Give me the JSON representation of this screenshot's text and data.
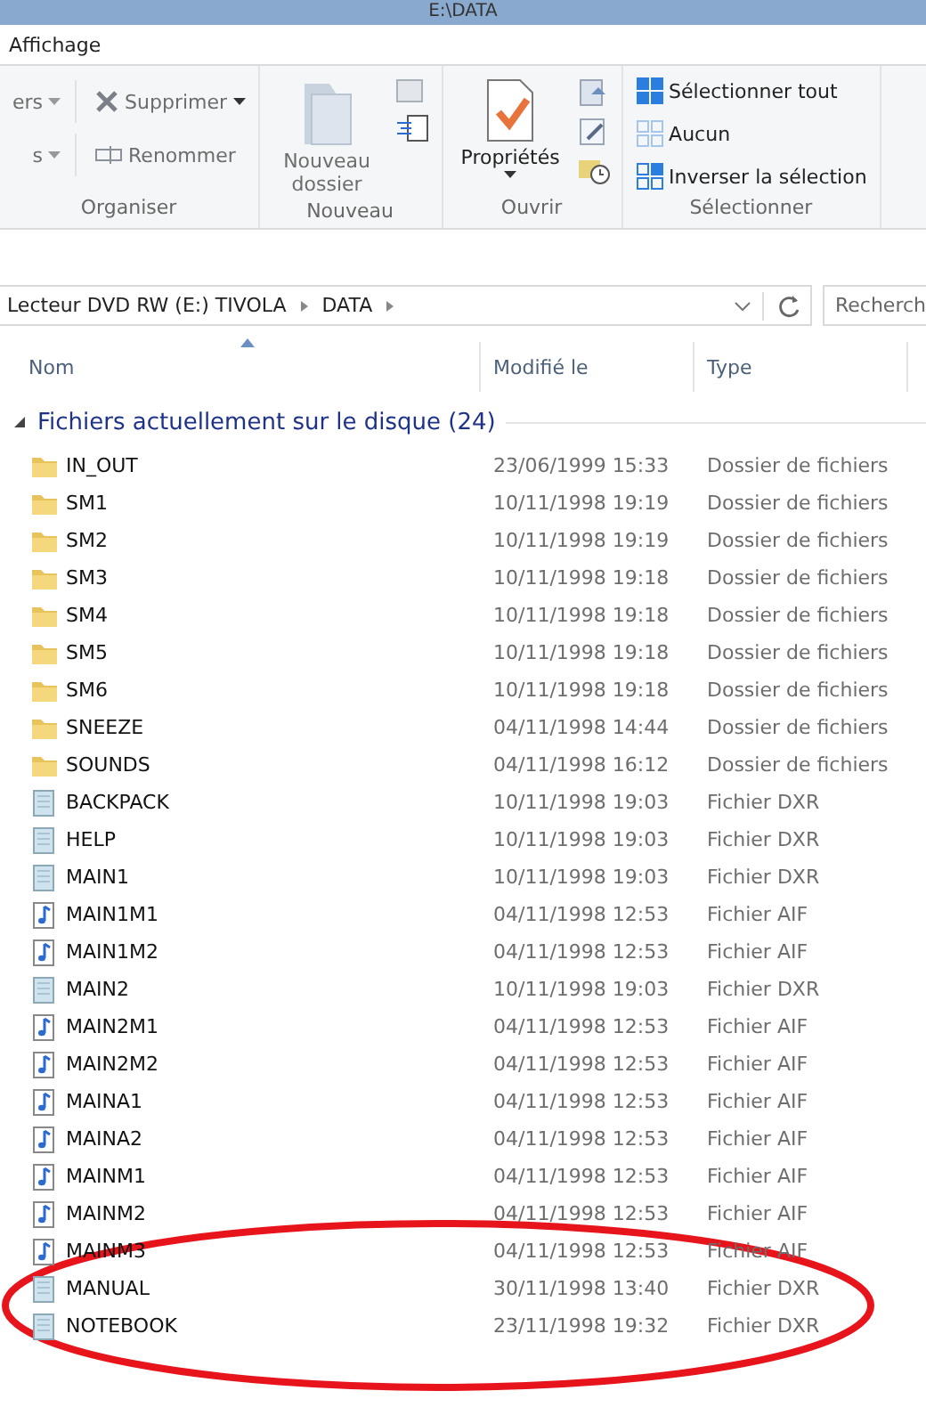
{
  "window": {
    "title": "E:\\DATA"
  },
  "menu_tabs": [
    "Affichage"
  ],
  "ribbon": {
    "groups": [
      {
        "label": "Organiser",
        "items": [
          {
            "text": "ers",
            "kind": "partial"
          },
          {
            "text": "s",
            "kind": "partial"
          },
          {
            "text": "Supprimer",
            "kind": "delete"
          },
          {
            "text": "Renommer",
            "kind": "rename"
          }
        ]
      },
      {
        "label": "Nouveau",
        "items": [
          {
            "text": "Nouveau dossier",
            "kind": "newfolder"
          }
        ]
      },
      {
        "label": "Ouvrir",
        "items": [
          {
            "text": "Propriétés",
            "kind": "properties"
          }
        ]
      },
      {
        "label": "Sélectionner",
        "items": [
          {
            "text": "Sélectionner tout",
            "kind": "selectall"
          },
          {
            "text": "Aucun",
            "kind": "none"
          },
          {
            "text": "Inverser la sélection",
            "kind": "invert"
          }
        ]
      }
    ]
  },
  "address": {
    "path": [
      "Lecteur DVD RW (E:) TIVOLA",
      "DATA"
    ],
    "search_placeholder": "Recherch"
  },
  "table": {
    "columns": [
      "Nom",
      "Modifié le",
      "Type"
    ],
    "group": "Fichiers actuellement sur le disque (24)",
    "rows": [
      {
        "name": "IN_OUT",
        "date": "23/06/1999 15:33",
        "type": "Dossier de fichiers",
        "kind": "folder"
      },
      {
        "name": "SM1",
        "date": "10/11/1998 19:19",
        "type": "Dossier de fichiers",
        "kind": "folder"
      },
      {
        "name": "SM2",
        "date": "10/11/1998 19:19",
        "type": "Dossier de fichiers",
        "kind": "folder"
      },
      {
        "name": "SM3",
        "date": "10/11/1998 19:18",
        "type": "Dossier de fichiers",
        "kind": "folder"
      },
      {
        "name": "SM4",
        "date": "10/11/1998 19:18",
        "type": "Dossier de fichiers",
        "kind": "folder"
      },
      {
        "name": "SM5",
        "date": "10/11/1998 19:18",
        "type": "Dossier de fichiers",
        "kind": "folder"
      },
      {
        "name": "SM6",
        "date": "10/11/1998 19:18",
        "type": "Dossier de fichiers",
        "kind": "folder"
      },
      {
        "name": "SNEEZE",
        "date": "04/11/1998 14:44",
        "type": "Dossier de fichiers",
        "kind": "folder"
      },
      {
        "name": "SOUNDS",
        "date": "04/11/1998 16:12",
        "type": "Dossier de fichiers",
        "kind": "folder"
      },
      {
        "name": "BACKPACK",
        "date": "10/11/1998 19:03",
        "type": "Fichier DXR",
        "kind": "dxr"
      },
      {
        "name": "HELP",
        "date": "10/11/1998 19:03",
        "type": "Fichier DXR",
        "kind": "dxr"
      },
      {
        "name": "MAIN1",
        "date": "10/11/1998 19:03",
        "type": "Fichier DXR",
        "kind": "dxr"
      },
      {
        "name": "MAIN1M1",
        "date": "04/11/1998 12:53",
        "type": "Fichier AIF",
        "kind": "aif"
      },
      {
        "name": "MAIN1M2",
        "date": "04/11/1998 12:53",
        "type": "Fichier AIF",
        "kind": "aif"
      },
      {
        "name": "MAIN2",
        "date": "10/11/1998 19:03",
        "type": "Fichier DXR",
        "kind": "dxr"
      },
      {
        "name": "MAIN2M1",
        "date": "04/11/1998 12:53",
        "type": "Fichier AIF",
        "kind": "aif"
      },
      {
        "name": "MAIN2M2",
        "date": "04/11/1998 12:53",
        "type": "Fichier AIF",
        "kind": "aif"
      },
      {
        "name": "MAINA1",
        "date": "04/11/1998 12:53",
        "type": "Fichier AIF",
        "kind": "aif"
      },
      {
        "name": "MAINA2",
        "date": "04/11/1998 12:53",
        "type": "Fichier AIF",
        "kind": "aif"
      },
      {
        "name": "MAINM1",
        "date": "04/11/1998 12:53",
        "type": "Fichier AIF",
        "kind": "aif"
      },
      {
        "name": "MAINM2",
        "date": "04/11/1998 12:53",
        "type": "Fichier AIF",
        "kind": "aif"
      },
      {
        "name": "MAINM3",
        "date": "04/11/1998 12:53",
        "type": "Fichier AIF",
        "kind": "aif"
      },
      {
        "name": "MANUAL",
        "date": "30/11/1998 13:40",
        "type": "Fichier DXR",
        "kind": "dxr"
      },
      {
        "name": "NOTEBOOK",
        "date": "23/11/1998 19:32",
        "type": "Fichier DXR",
        "kind": "dxr"
      }
    ]
  }
}
